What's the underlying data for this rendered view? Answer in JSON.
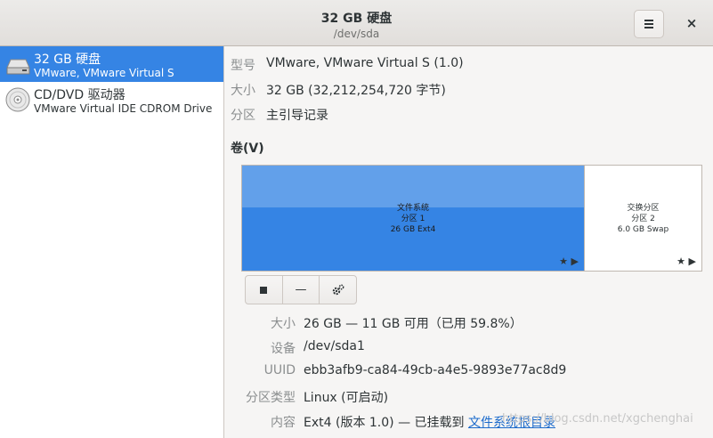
{
  "header": {
    "title": "32 GB 硬盘",
    "subtitle": "/dev/sda",
    "menu_icon": "hamburger-menu-icon",
    "close_label": "×"
  },
  "sidebar": {
    "items": [
      {
        "name": "32 GB 硬盘",
        "subtitle": "VMware, VMware Virtual S",
        "icon": "hard-disk-icon",
        "selected": true
      },
      {
        "name": "CD/DVD 驱动器",
        "subtitle": "VMware Virtual IDE CDROM Drive",
        "icon": "optical-disc-icon",
        "selected": false
      }
    ]
  },
  "disk_info": {
    "model_label": "型号",
    "model_value": "VMware, VMware Virtual S (1.0)",
    "size_label": "大小",
    "size_value": "32 GB (32,212,254,720 字节)",
    "partition_label": "分区",
    "partition_value": "主引导记录"
  },
  "volumes": {
    "title": "卷(V)",
    "partitions": [
      {
        "line1": "文件系统",
        "line2": "分区 1",
        "line3": "26 GB Ext4",
        "selected": true
      },
      {
        "line1": "交换分区",
        "line2": "分区 2",
        "line3": "6.0 GB Swap",
        "selected": false
      }
    ],
    "toolbar": {
      "stop_icon": "stop-icon",
      "remove_icon": "minus-icon",
      "settings_icon": "gears-icon"
    }
  },
  "details": {
    "size_label": "大小",
    "size_value": "26 GB — 11 GB 可用（已用 59.8%）",
    "device_label": "设备",
    "device_value": "/dev/sda1",
    "uuid_label": "UUID",
    "uuid_value": "ebb3afb9-ca84-49cb-a4e5-9893e77ac8d9",
    "type_label": "分区类型",
    "type_value": "Linux (可启动)",
    "contents_label": "内容",
    "contents_value": "Ext4 (版本 1.0) — 已挂载到 ",
    "contents_link": "文件系统根目录"
  },
  "watermark": "https://blog.csdn.net/xgchenghai",
  "colors": {
    "accent": "#3584e4",
    "partition_light": "#62a0ea",
    "link": "#1b6acb"
  }
}
